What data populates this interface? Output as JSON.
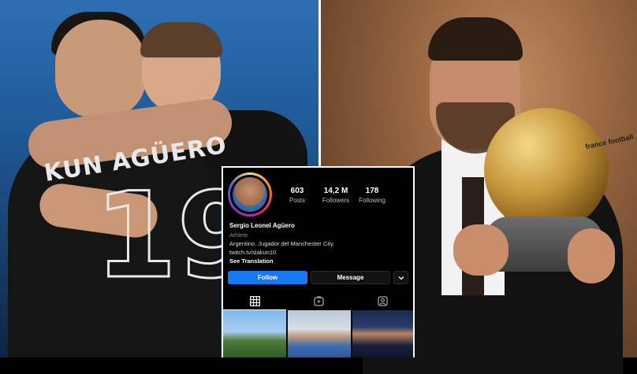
{
  "left_photo": {
    "jersey_name": "KUN AGÜERO",
    "jersey_number": "19"
  },
  "right_photo": {
    "ball_text": "france football"
  },
  "instagram": {
    "stats": [
      {
        "value": "603",
        "label": "Posts"
      },
      {
        "value": "14,2 M",
        "label": "Followers"
      },
      {
        "value": "178",
        "label": "Following"
      }
    ],
    "name": "Sergio Leonel Agüero",
    "category": "Athlete",
    "bio": "Argentino. Jugador del Manchester City.",
    "link": "twitch.tv/slakun10",
    "translation": "See Translation",
    "follow_label": "Follow",
    "message_label": "Message",
    "more_icon": "chevron-down-icon",
    "tabs": [
      "grid-icon",
      "reels-icon",
      "tagged-icon"
    ],
    "colors": {
      "follow": "#1877f2",
      "background": "#000000"
    }
  }
}
